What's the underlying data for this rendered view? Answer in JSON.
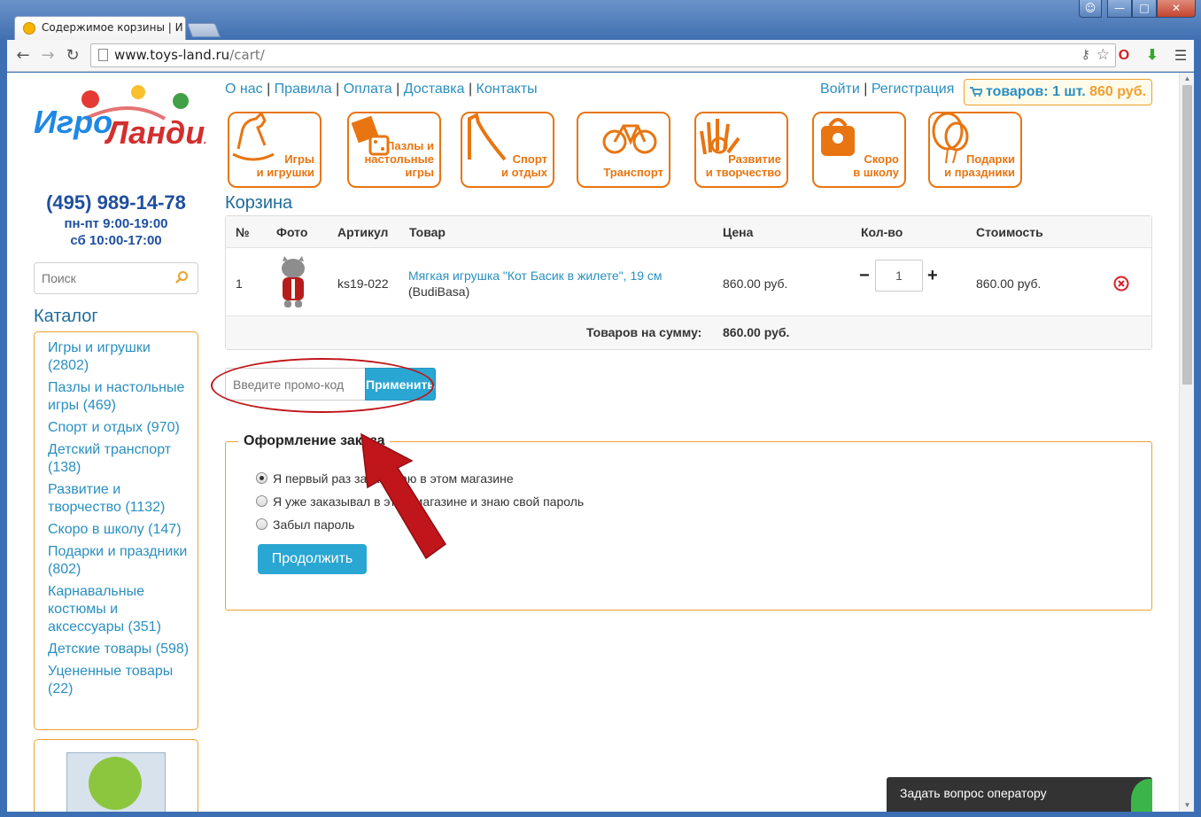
{
  "browser": {
    "tab_title": "Содержимое корзины | И",
    "url_host": "www.toys-land.ru",
    "url_path": "/cart/",
    "icons": [
      "back-icon",
      "forward-icon",
      "reload-icon",
      "page-icon",
      "key-icon",
      "star-icon",
      "menu-icon"
    ]
  },
  "site": {
    "logo_text": "ИгроЛандия",
    "phone": "(495) 989-14-78",
    "hours_weekdays": "пн-пт 9:00-19:00",
    "hours_saturday": "сб 10:00-17:00",
    "search_placeholder": "Поиск",
    "top_links": [
      "О нас",
      "Правила",
      "Оплата",
      "Доставка",
      "Контакты"
    ],
    "auth_links": [
      "Войти",
      "Регистрация"
    ],
    "cart_badge_label": "товаров: 1 шт.",
    "cart_badge_sum": "860 руб."
  },
  "categories": [
    {
      "label": "Игры\nи игрушки",
      "icon": "rocking-horse-icon"
    },
    {
      "label": "Пазлы и\nнастольные игры",
      "icon": "puzzle-dice-icon"
    },
    {
      "label": "Спорт\nи отдых",
      "icon": "slide-icon"
    },
    {
      "label": "Транспорт",
      "icon": "bicycle-icon"
    },
    {
      "label": "Развитие\nи творчество",
      "icon": "paint-hand-icon"
    },
    {
      "label": "Скоро\nв школу",
      "icon": "schoolbag-icon"
    },
    {
      "label": "Подарки\nи праздники",
      "icon": "balloon-icon"
    }
  ],
  "catalog": {
    "title": "Каталог",
    "items": [
      "Игры и игрушки (2802)",
      "Пазлы и настольные игры (469)",
      "Спорт и отдых (970)",
      "Детский транспорт (138)",
      "Развитие и творчество (1132)",
      "Скоро в школу (147)",
      "Подарки и праздники (802)",
      "Карнавальные костюмы и аксессуары (351)",
      "Детские товары (598)",
      "Уцененные товары (22)"
    ]
  },
  "cart": {
    "title": "Корзина",
    "columns": [
      "№",
      "Фото",
      "Артикул",
      "Товар",
      "Цена",
      "Кол-во",
      "Стоимость"
    ],
    "row": {
      "num": "1",
      "sku": "ks19-022",
      "name": "Мягкая игрушка \"Кот Басик в жилете\", 19 см",
      "brand": "(BudiBasa)",
      "price": "860.00 руб.",
      "qty": "1",
      "total": "860.00 руб."
    },
    "sum_label": "Товаров на сумму:",
    "sum_value": "860.00 руб.",
    "minus": "−",
    "plus": "+"
  },
  "promo": {
    "placeholder": "Введите промо-код",
    "button": "Применить"
  },
  "order": {
    "legend": "Оформление заказа",
    "options": [
      {
        "label": "Я первый раз заказываю в этом магазине",
        "checked": true
      },
      {
        "label": "Я уже заказывал в этом магазине и знаю свой пароль",
        "checked": false
      },
      {
        "label": "Забыл пароль",
        "checked": false
      }
    ],
    "continue": "Продолжить"
  },
  "chat": {
    "label": "Задать вопрос оператору"
  },
  "colors": {
    "accent": "#2aa6d2",
    "orange": "#e87511",
    "link": "#2a8fc0",
    "annotation": "#c0151b"
  }
}
